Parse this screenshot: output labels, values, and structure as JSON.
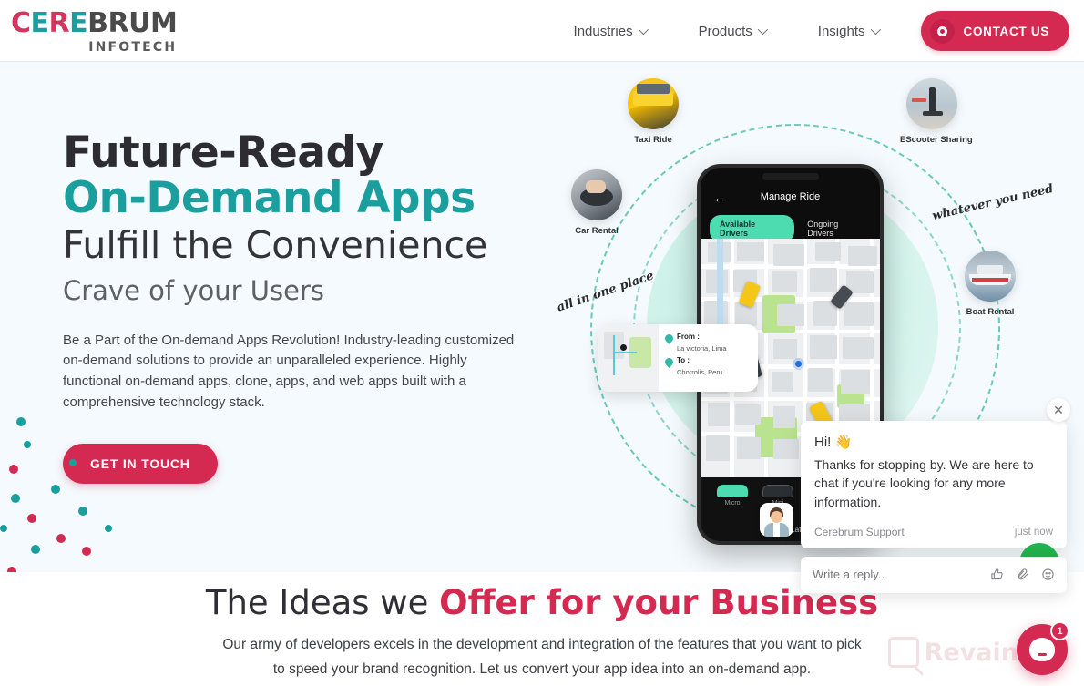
{
  "header": {
    "logo": {
      "part1": "C",
      "part2": "E",
      "part3": "R",
      "part4": "E",
      "part5": "BRUM",
      "sub": "INFOTECH"
    },
    "nav": [
      {
        "label": "Industries",
        "icon": "chevron-down-icon"
      },
      {
        "label": "Products",
        "icon": "chevron-down-icon"
      },
      {
        "label": "Insights",
        "icon": "chevron-down-icon"
      }
    ],
    "contact_button": {
      "label": "CONTACT US",
      "icon": "circle-target-icon"
    }
  },
  "hero": {
    "title_line1": "Future-Ready",
    "title_line2": "On-Demand Apps",
    "title_line3": "Fulfill the Convenience",
    "title_line4": "Crave of your Users",
    "paragraph": "Be a Part of the On-demand Apps Revolution! Industry-leading customized on-demand solutions to provide an unparalleled experience. Highly functional on-demand apps, clone, apps, and web apps built with a comprehensive technology stack.",
    "cta_label": "GET IN TOUCH",
    "services": [
      {
        "label": "Taxi Ride"
      },
      {
        "label": "Car Rental"
      },
      {
        "label": "EScooter Sharing"
      },
      {
        "label": "Boat Rental"
      }
    ],
    "script_left": "all in one place",
    "script_right": "whatever you need",
    "phone": {
      "title": "Manage Ride",
      "back_icon": "arrow-left-icon",
      "tab_active": "Available Drivers",
      "tab_inactive": "Ongoing Drivers",
      "vehicles": [
        "Micro",
        "Mini"
      ],
      "ride_later": "Ride Later"
    },
    "map_card": {
      "from_label": "From :",
      "from_value": "La victoria, Lima",
      "to_label": "To :",
      "to_value": "Chorrolis, Peru"
    }
  },
  "chat": {
    "close_icon": "close-icon",
    "greeting": "Hi! 👋",
    "message": "Thanks for stopping by. We are here to chat if you're looking for any more information.",
    "sender": "Cerebrum Support",
    "time": "just now",
    "reply_placeholder": "Write a reply..",
    "icons": [
      "thumbs-up-icon",
      "paperclip-icon",
      "emoji-icon"
    ]
  },
  "section2": {
    "title_plain": "The Ideas we ",
    "title_accent": "Offer for your Business",
    "subtitle_line1": "Our army of developers excels in the development and integration of the features that you want to pick",
    "subtitle_line2": "to speed your brand recognition. Let us convert your app idea into an on-demand app."
  },
  "launcher": {
    "badge": "1"
  },
  "watermark": {
    "text": "Revain"
  },
  "colors": {
    "crimson": "#d42a52",
    "teal": "#1a9e9e",
    "mint": "#4ddbb0",
    "hero_bg": "#f4fafd",
    "dark_text": "#2c2c32"
  }
}
